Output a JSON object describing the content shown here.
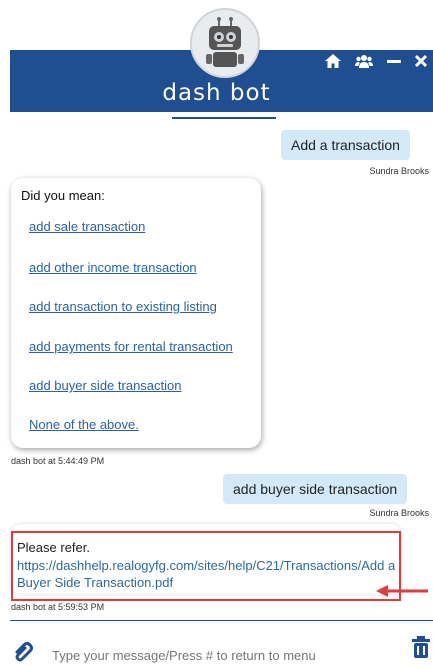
{
  "header": {
    "title": "dash bot",
    "icons": [
      "home-icon",
      "users-icon",
      "minimize-icon",
      "close-icon"
    ]
  },
  "messages": {
    "user1": {
      "text": "Add a transaction",
      "sender": "Sundra Brooks"
    },
    "bot1": {
      "intro": "Did you mean:",
      "options": [
        "add sale transaction",
        "add other income transaction",
        "add transaction to existing listing",
        "add payments for rental transaction",
        "add buyer side transaction",
        "None of the above."
      ],
      "timestamp": "dash bot at 5:44:49 PM"
    },
    "user2": {
      "text": "add buyer side transaction",
      "sender": "Sundra Brooks"
    },
    "bot2": {
      "text": "Please refer.",
      "link": "https://dashhelp.realogyfg.com/sites/help/C21/Transactions/Add a Buyer Side Transaction.pdf",
      "timestamp": "dash bot at 5:59:53 PM"
    }
  },
  "footer": {
    "placeholder": "Type your message/Press # to return to menu"
  },
  "colors": {
    "brand": "#1f4f91",
    "user_bubble": "#d3e9f8",
    "link": "#2a62a8",
    "highlight": "#e23b3b"
  }
}
